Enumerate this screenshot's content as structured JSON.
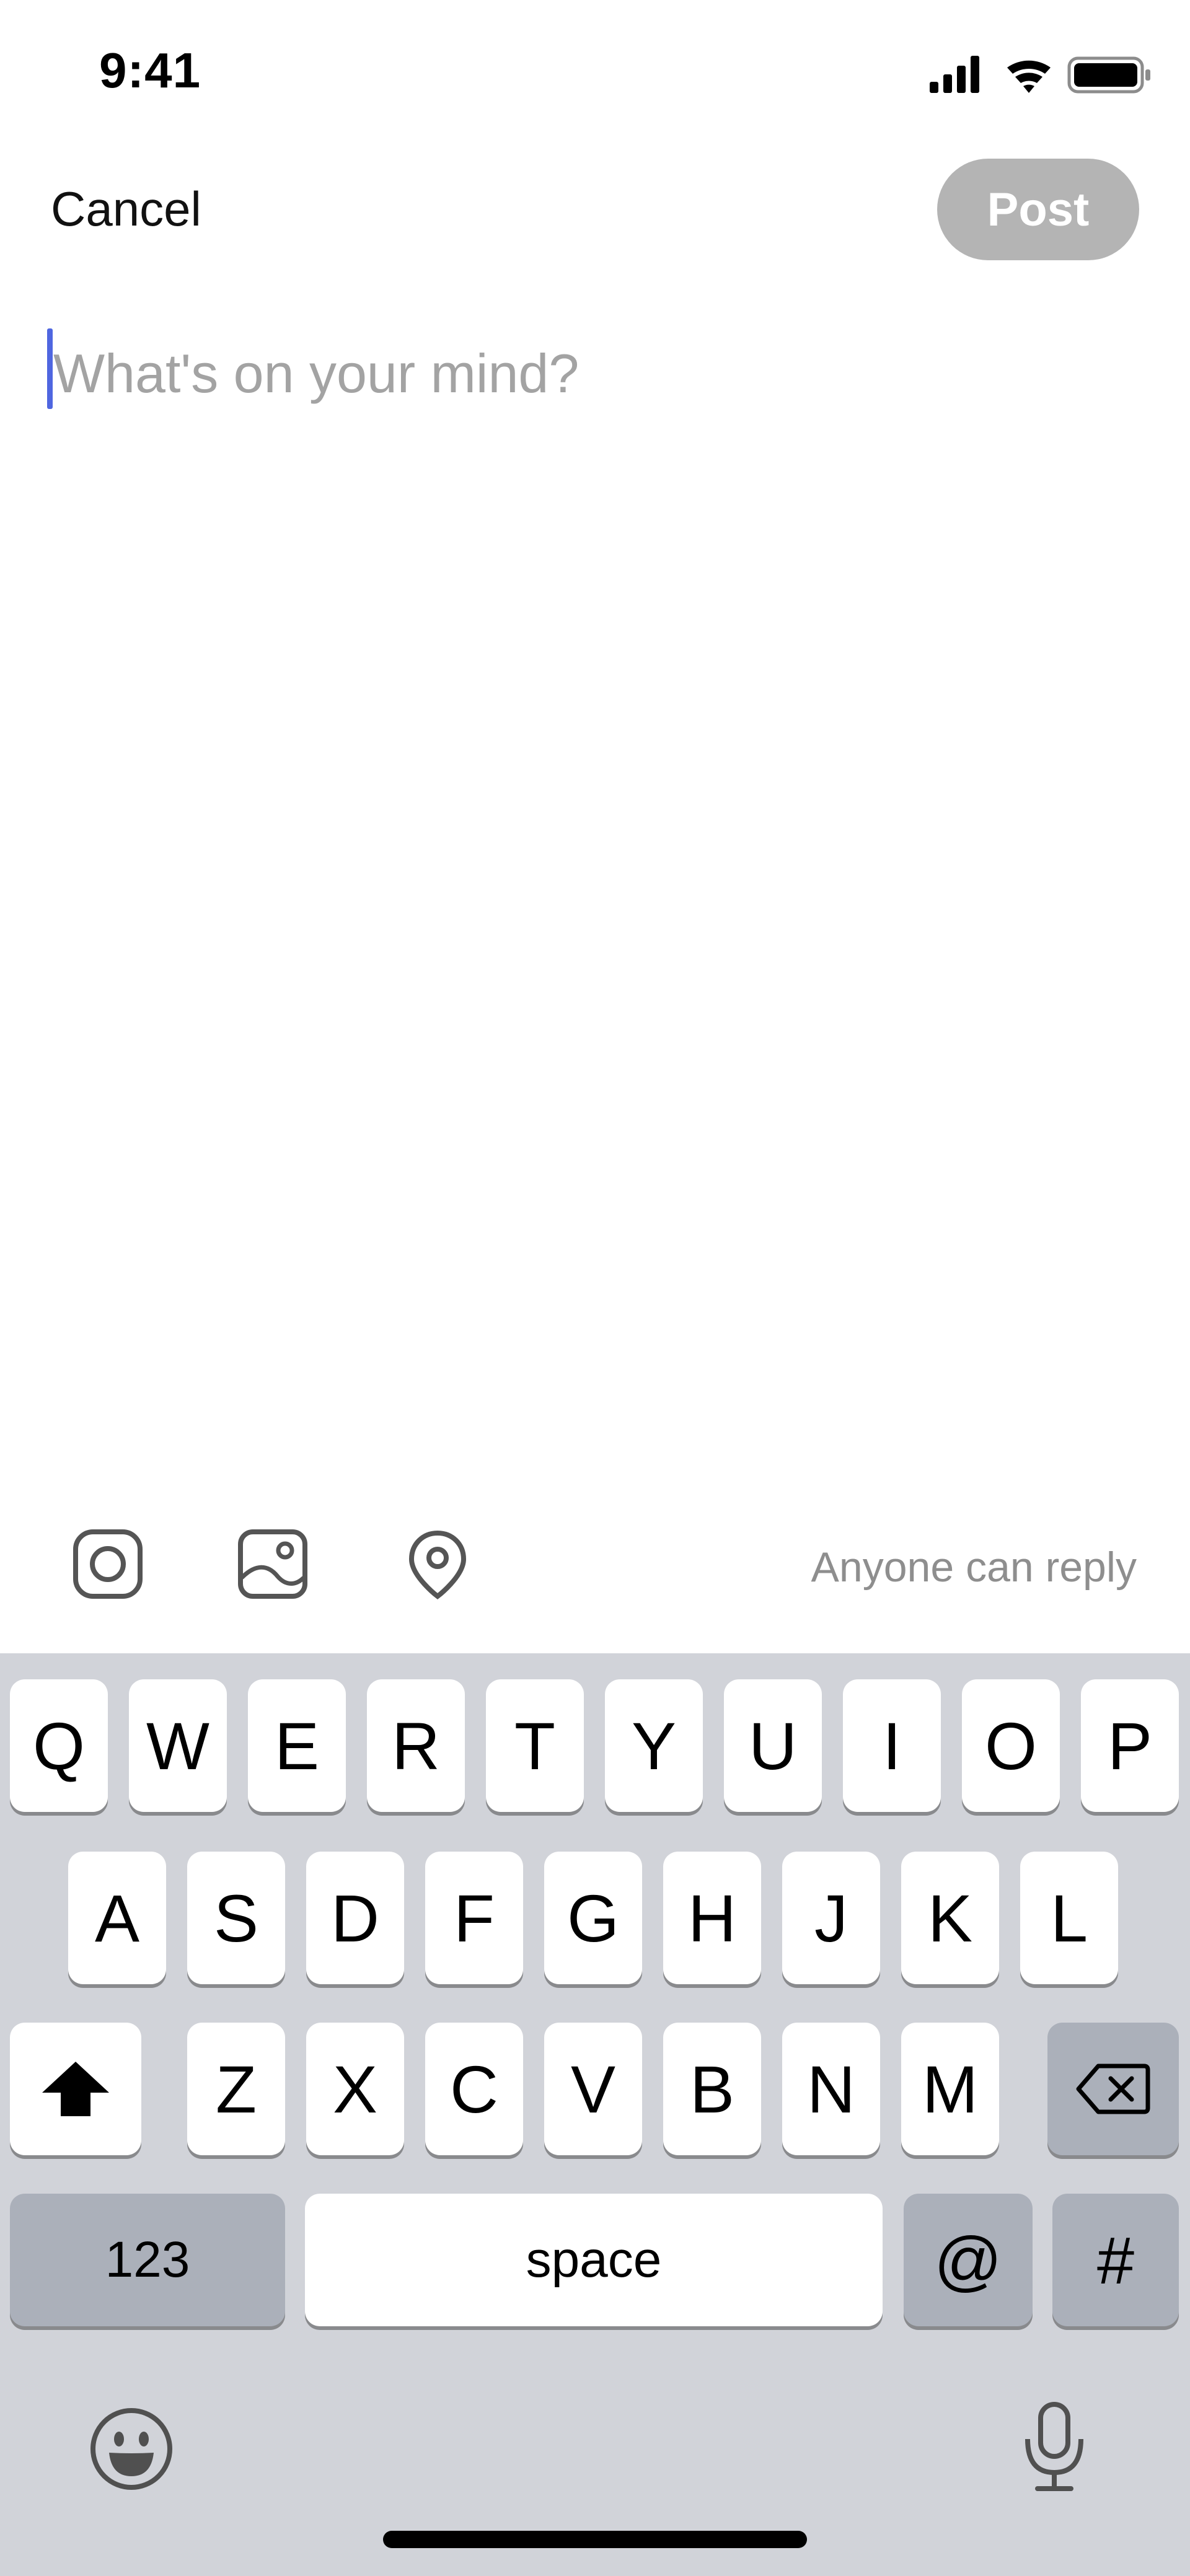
{
  "status_bar": {
    "time": "9:41",
    "icons": [
      "cellular-signal-icon",
      "wifi-icon",
      "battery-icon"
    ]
  },
  "nav": {
    "cancel_label": "Cancel",
    "post_label": "Post"
  },
  "composer": {
    "placeholder": "What's on your mind?",
    "value": ""
  },
  "toolbar": {
    "icons": [
      "camera-icon",
      "image-icon",
      "location-icon"
    ],
    "reply_setting": "Anyone can reply"
  },
  "keyboard": {
    "row1": [
      "Q",
      "W",
      "E",
      "R",
      "T",
      "Y",
      "U",
      "I",
      "O",
      "P"
    ],
    "row2": [
      "A",
      "S",
      "D",
      "F",
      "G",
      "H",
      "J",
      "K",
      "L"
    ],
    "row3": [
      "Z",
      "X",
      "C",
      "V",
      "B",
      "N",
      "M"
    ],
    "numbers_label": "123",
    "space_label": "space",
    "at_label": "@",
    "hash_label": "#"
  },
  "colors": {
    "post_button": "#b4b4b4",
    "caret": "#4f66e0",
    "keyboard_bg": "#d1d3d9",
    "special_key": "#abb0ba"
  }
}
